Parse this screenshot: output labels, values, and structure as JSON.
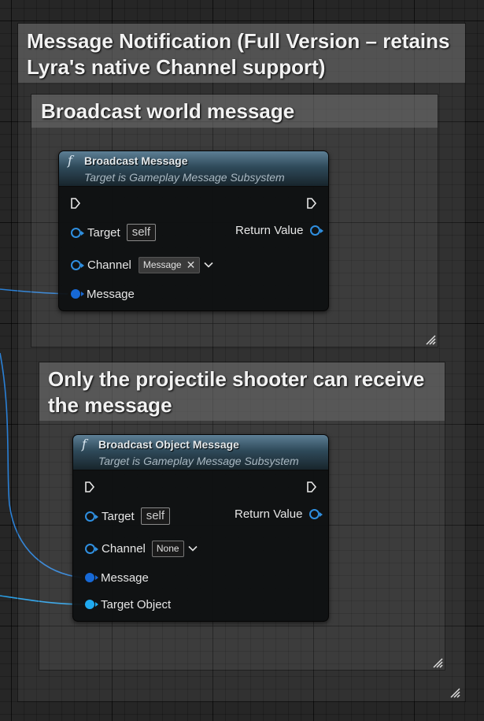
{
  "comments": {
    "outer": {
      "title": "Message Notification (Full Version – retains Lyra's native Channel support)"
    },
    "broadcast": {
      "title": "Broadcast world message"
    },
    "object": {
      "title": "Only the projectile shooter can receive the message"
    }
  },
  "nodes": {
    "broadcast_message": {
      "title": "Broadcast Message",
      "subtitle": "Target is Gameplay Message Subsystem",
      "pins": {
        "target": "Target",
        "target_value": "self",
        "channel": "Channel",
        "channel_tag": "Message",
        "message": "Message",
        "return_value": "Return Value"
      }
    },
    "broadcast_object_message": {
      "title": "Broadcast Object Message",
      "subtitle": "Target is Gameplay Message Subsystem",
      "pins": {
        "target": "Target",
        "target_value": "self",
        "channel": "Channel",
        "channel_value": "None",
        "message": "Message",
        "target_object": "Target Object",
        "return_value": "Return Value"
      }
    }
  },
  "icons": {
    "function": "function-icon",
    "exec": "exec-pin-icon",
    "clear": "close-icon",
    "dropdown": "chevron-down-icon",
    "resize": "resize-grip-icon"
  },
  "colors": {
    "background": "#262626",
    "node_header": "#2f4a5a",
    "pin_object": "#2f8fe0",
    "pin_struct": "#1769d6",
    "pin_target_object": "#20aaf0",
    "wire": "#2a7fd4"
  }
}
